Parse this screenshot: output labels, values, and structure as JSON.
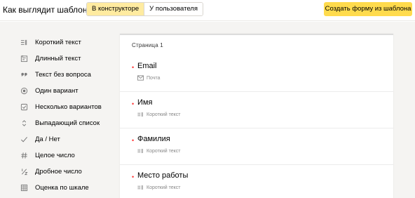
{
  "header": {
    "title": "Как выглядит шаблон",
    "view_toggle": [
      "В конструкторе",
      "У пользователя"
    ],
    "create_button": "Создать форму из шаблона"
  },
  "sidebar": {
    "items": [
      {
        "label": "Короткий текст",
        "icon": "short-text-icon"
      },
      {
        "label": "Длинный текст",
        "icon": "long-text-icon"
      },
      {
        "label": "Текст без вопроса",
        "icon": "quote-icon"
      },
      {
        "label": "Один вариант",
        "icon": "radio-icon"
      },
      {
        "label": "Несколько вариантов",
        "icon": "checkbox-icon"
      },
      {
        "label": "Выпадающий список",
        "icon": "dropdown-icon"
      },
      {
        "label": "Да / Нет",
        "icon": "check-icon"
      },
      {
        "label": "Целое число",
        "icon": "hash-icon"
      },
      {
        "label": "Дробное число",
        "icon": "fraction-icon"
      },
      {
        "label": "Оценка по шкале",
        "icon": "scale-icon"
      }
    ]
  },
  "form": {
    "page_label": "Страница 1",
    "fields": [
      {
        "label": "Email",
        "type": "Почта",
        "type_icon": "mail-icon"
      },
      {
        "label": "Имя",
        "type": "Короткий текст",
        "type_icon": "short-text-icon"
      },
      {
        "label": "Фамилия",
        "type": "Короткий текст",
        "type_icon": "short-text-icon"
      },
      {
        "label": "Место работы",
        "type": "Короткий текст",
        "type_icon": "short-text-icon"
      }
    ]
  }
}
